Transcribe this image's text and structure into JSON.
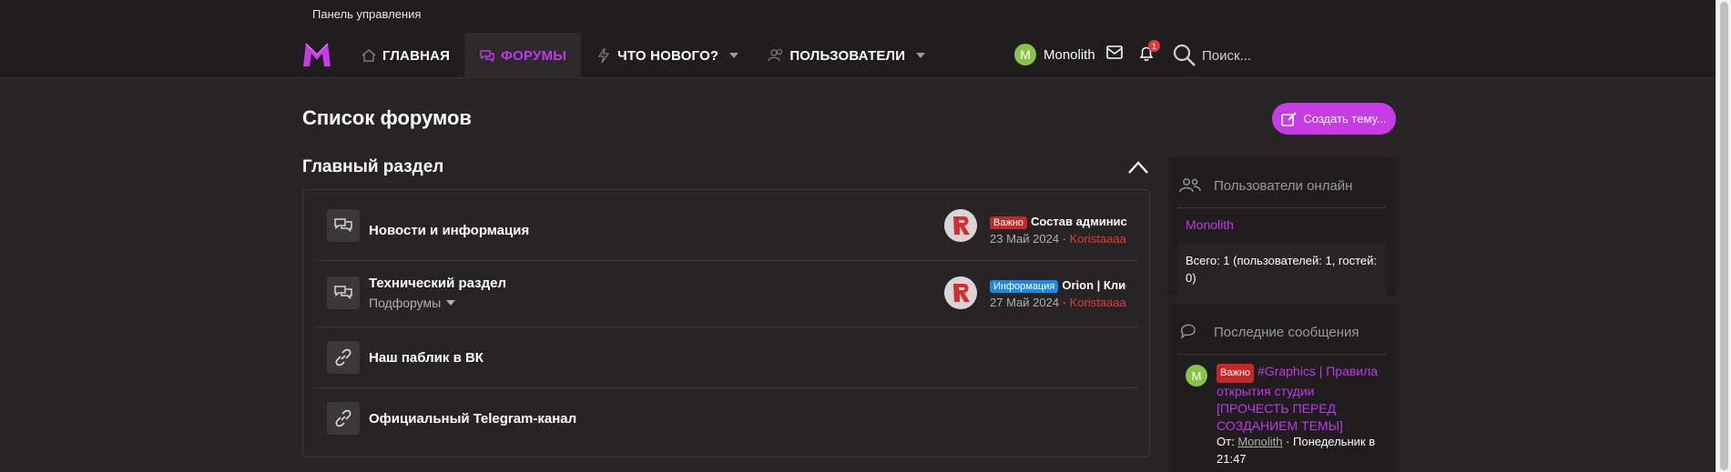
{
  "header": {
    "admin_link": "Панель управления",
    "nav": [
      {
        "label": "ГЛАВНАЯ",
        "icon": "home-icon"
      },
      {
        "label": "ФОРУМЫ",
        "icon": "forums-icon",
        "active": true
      },
      {
        "label": "ЧТО НОВОГО?",
        "icon": "bolt-icon"
      },
      {
        "label": "ПОЛЬЗОВАТЕЛИ",
        "icon": "users-icon"
      }
    ],
    "username": "Monolith",
    "avatar_letter": "M",
    "alerts_count": "1",
    "search_label": "Поиск..."
  },
  "main": {
    "page_title": "Список форумов",
    "create_button": "Создать тему...",
    "section_title": "Главный раздел",
    "forums": [
      {
        "title": "Новости и информация",
        "icon": "chat-icon",
        "last_prefix": "Важно",
        "last_title": "Состав администрации",
        "last_date": "23 Май 2024",
        "last_author": "Koristaaaa"
      },
      {
        "title": "Технический раздел",
        "icon": "chat-icon",
        "sub_label": "Подфорумы",
        "last_prefix": "Информация",
        "last_title": "Orion | Клиенты",
        "last_date": "27 Май 2024",
        "last_author": "Koristaaaa"
      },
      {
        "title": "Наш паблик в ВК",
        "icon": "link-icon"
      },
      {
        "title": "Официальный Telegram-канал",
        "icon": "link-icon"
      }
    ]
  },
  "sidebar": {
    "online_title": "Пользователи онлайн",
    "online_user": "Monolith",
    "online_total": "Всего: 1 (пользователей: 1, гостей: 0)",
    "latest_title": "Последние сообщения",
    "latest_avatar_letter": "M",
    "latest_prefix": "Важно",
    "latest_post": "#Graphics | Правила открытия студии [ПРОЧЕСТЬ ПЕРЕД СОЗДАНИЕМ ТЕМЫ]",
    "latest_from": "От:",
    "latest_author": "Monolith",
    "latest_when": "· Понедельник в 21:47"
  },
  "colors": {
    "accent": "#c038e8",
    "button": "#c73ce6",
    "bg": "#272425",
    "header_bg": "#1f1d1e"
  }
}
